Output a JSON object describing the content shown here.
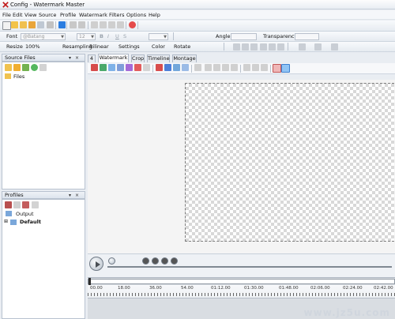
{
  "window": {
    "title": "Config - Watermark Master"
  },
  "menu": [
    "File",
    "Edit",
    "View",
    "Source",
    "Profile",
    "Watermark",
    "Filters",
    "Options",
    "Help"
  ],
  "toolbar2": {
    "font_label": "Font",
    "font_value": "@Batang",
    "size_value": "12",
    "angle_label": "Angle",
    "transparency_label": "Transparency"
  },
  "toolbar3": {
    "resize": "Resize",
    "resize_value": "100%",
    "resampling": "Resampling",
    "resampling_value": "Bilinear",
    "settings": "Settings",
    "color": "Color",
    "rotate": "Rotate"
  },
  "source_files": {
    "title": "Source Files",
    "items": [
      "Files"
    ]
  },
  "profiles": {
    "title": "Profiles",
    "items": [
      "Output",
      "Default"
    ]
  },
  "tabs": {
    "number": "4",
    "watermark": "Watermark",
    "crop": "Crop",
    "timeline": "Timeline",
    "montage": "Montage"
  },
  "timeline_ticks": [
    "00.00",
    "18.00",
    "36.00",
    "54.00",
    "01:12.00",
    "01:30.00",
    "01:48.00",
    "02:06.00",
    "02:24.00",
    "02:42.00"
  ],
  "watermark_text": "www.jz5u.com"
}
